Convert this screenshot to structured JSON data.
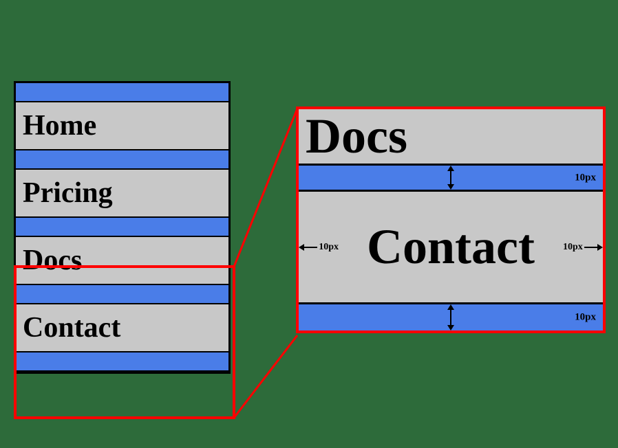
{
  "background_color": "#2d6b3a",
  "nav": {
    "items": [
      {
        "label": "Home",
        "type": "item"
      },
      {
        "label": "Pricing",
        "type": "item"
      },
      {
        "label": "Docs",
        "type": "item"
      },
      {
        "label": "Contact",
        "type": "item"
      }
    ]
  },
  "zoom": {
    "docs_label": "Docs",
    "contact_label": "Contact",
    "padding_label_top": "10px",
    "padding_label_bottom": "10px",
    "padding_label_left": "10px",
    "padding_label_right": "10px"
  }
}
